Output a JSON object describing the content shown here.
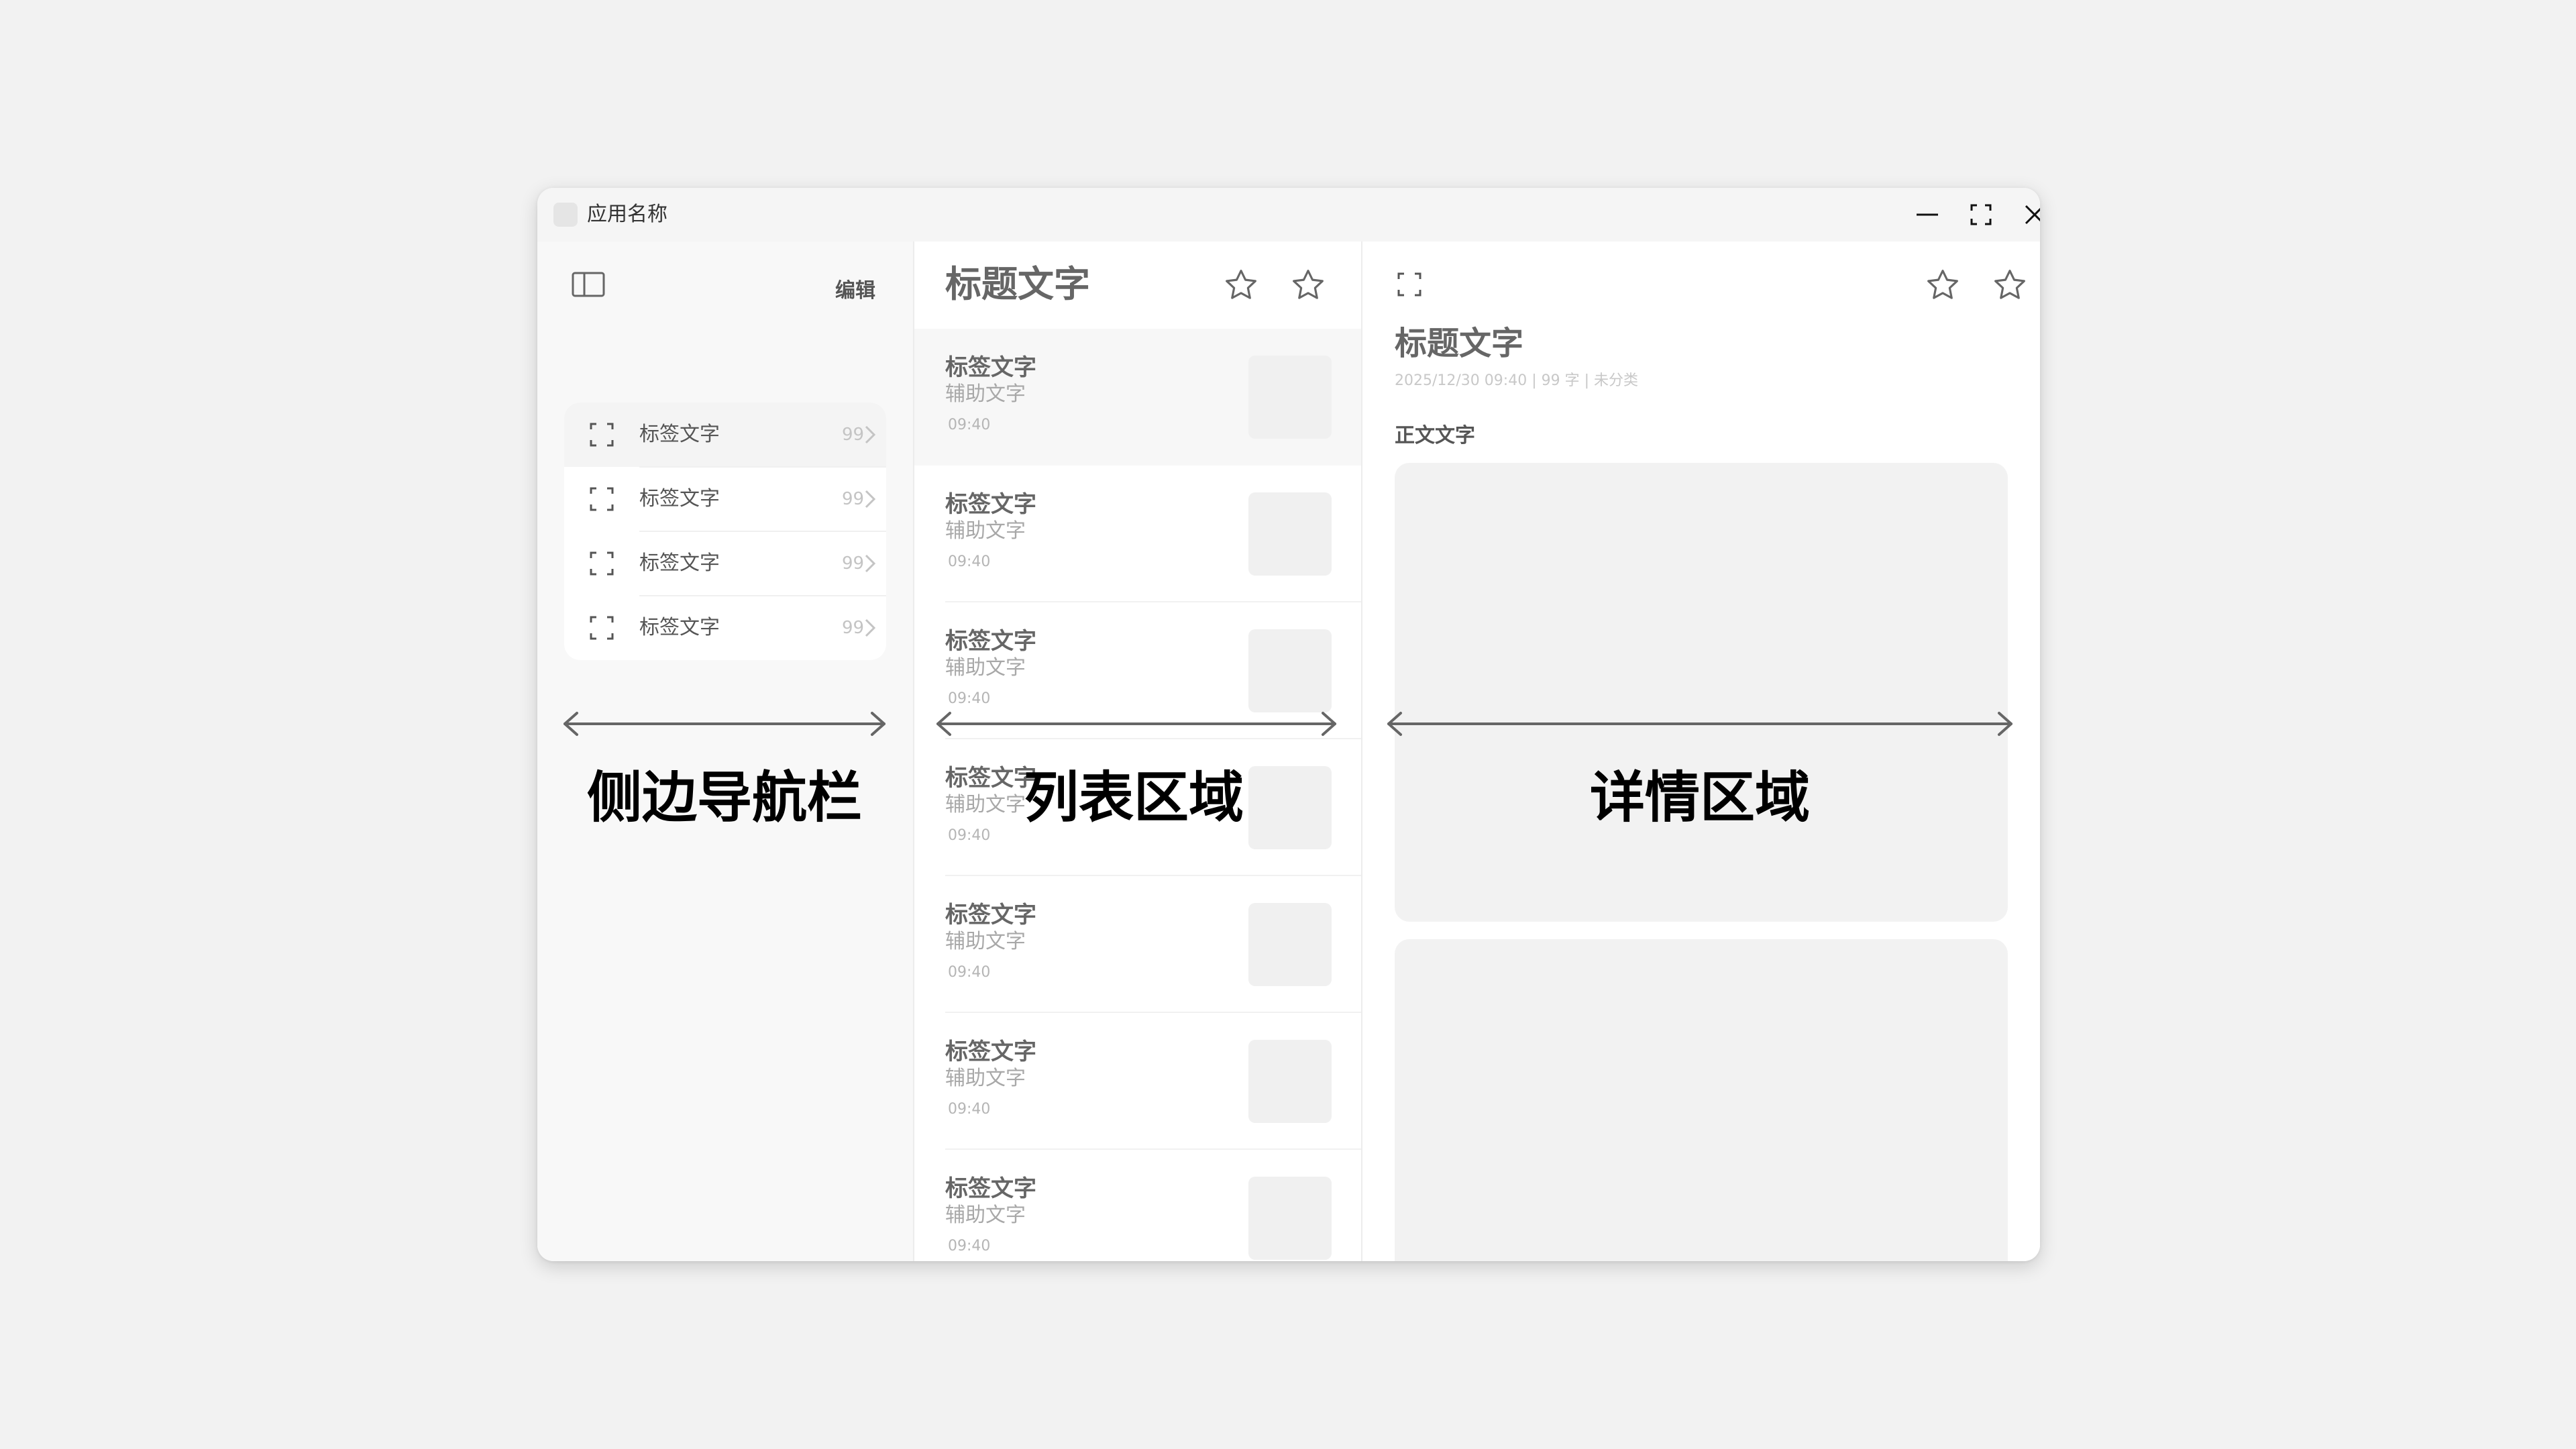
{
  "window": {
    "app_name": "应用名称"
  },
  "sidebar": {
    "edit_label": "编辑",
    "items": [
      {
        "label": "标签文字",
        "count": "99",
        "selected": true
      },
      {
        "label": "标签文字",
        "count": "99",
        "selected": false
      },
      {
        "label": "标签文字",
        "count": "99",
        "selected": false
      },
      {
        "label": "标签文字",
        "count": "99",
        "selected": false
      }
    ]
  },
  "list": {
    "title": "标题文字",
    "items": [
      {
        "label": "标签文字",
        "sub": "辅助文字",
        "time": "09:40",
        "selected": true
      },
      {
        "label": "标签文字",
        "sub": "辅助文字",
        "time": "09:40"
      },
      {
        "label": "标签文字",
        "sub": "辅助文字",
        "time": "09:40"
      },
      {
        "label": "标签文字",
        "sub": "辅助文字",
        "time": "09:40"
      },
      {
        "label": "标签文字",
        "sub": "辅助文字",
        "time": "09:40"
      },
      {
        "label": "标签文字",
        "sub": "辅助文字",
        "time": "09:40"
      },
      {
        "label": "标签文字",
        "sub": "辅助文字",
        "time": "09:40"
      }
    ]
  },
  "detail": {
    "title": "标题文字",
    "meta": "2025/12/30  09:40  | 99 字 | 未分类",
    "body_label": "正文文字"
  },
  "annotations": {
    "sidebar": "侧边导航栏",
    "list": "列表区域",
    "detail": "详情区域"
  },
  "icons": {
    "sidebar_toggle": "sidebar-toggle-icon",
    "favorite": "star-icon",
    "expand": "expand-icon",
    "minimize": "minimize-icon",
    "maximize": "maximize-icon",
    "close": "close-icon",
    "chevron": "chevron-right-icon"
  },
  "colors": {
    "background": "#f2f2f2",
    "window": "#f9f9f9",
    "placeholder": "#f0f0f0"
  }
}
